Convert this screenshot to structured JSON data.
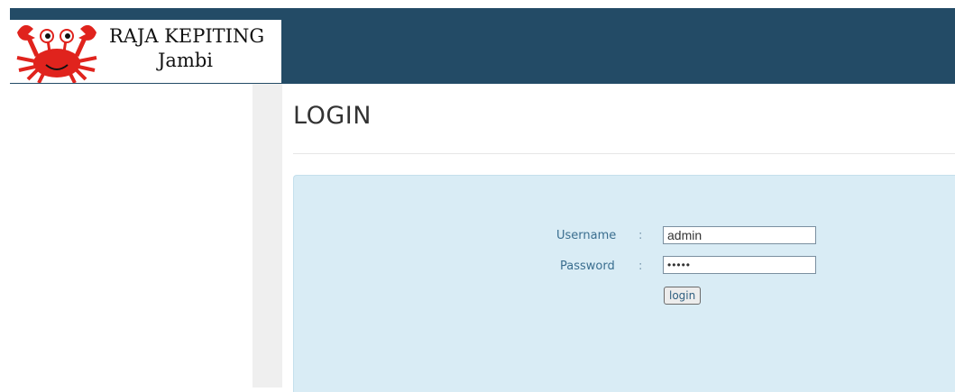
{
  "header": {
    "brand_name": "RAJA KEPITING",
    "brand_location": "Jambi",
    "logo_icon": "crab-icon",
    "bar_color": "#234b66"
  },
  "page": {
    "title": "LOGIN"
  },
  "login_form": {
    "username_label": "Username",
    "password_label": "Password",
    "separator": ":",
    "username_value": "admin",
    "password_value": "admin",
    "submit_label": "login",
    "panel_color": "#d9ecf5"
  }
}
